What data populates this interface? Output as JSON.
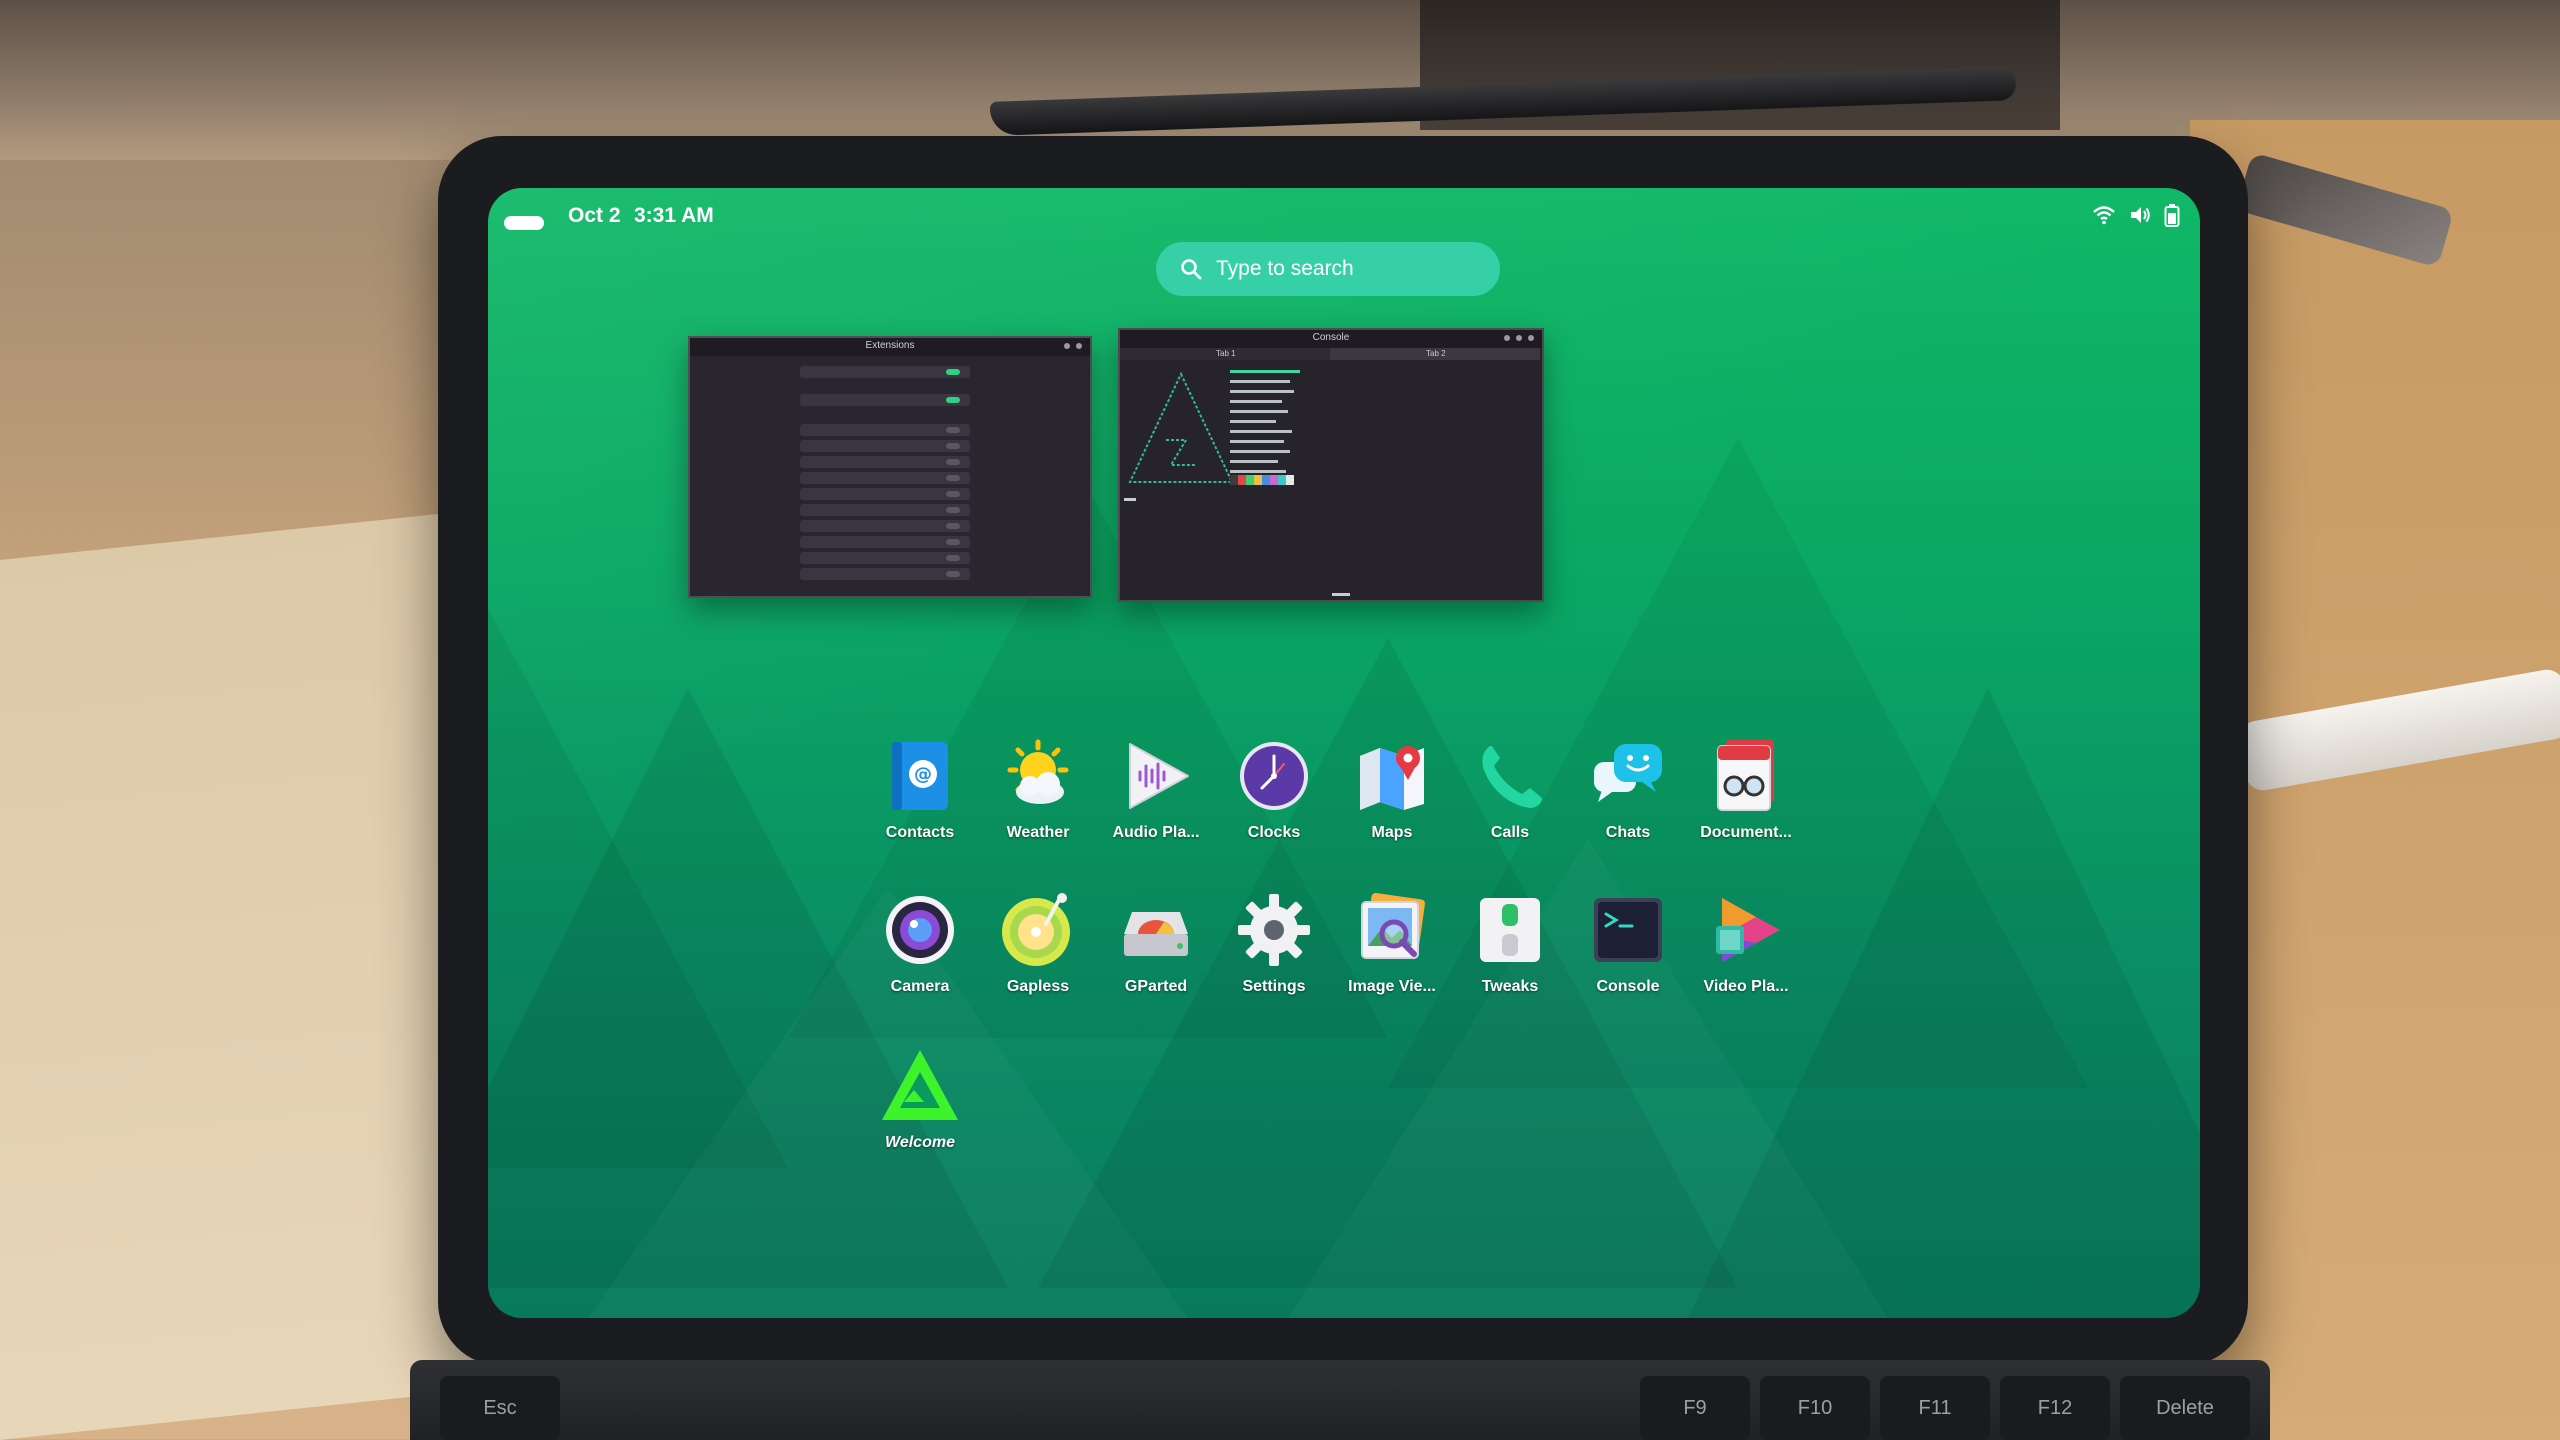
{
  "status_bar": {
    "date": "Oct 2",
    "time": "3:31 AM",
    "icons": [
      "wifi-icon",
      "volume-icon",
      "battery-icon"
    ]
  },
  "search": {
    "placeholder": "Type to search",
    "icon": "search-icon"
  },
  "windows": [
    {
      "name": "Extensions"
    },
    {
      "name": "Console",
      "tabs": [
        "Tab 1",
        "Tab 2"
      ]
    }
  ],
  "apps_row1": [
    {
      "label": "Contacts",
      "icon": "contacts-icon"
    },
    {
      "label": "Weather",
      "icon": "weather-icon"
    },
    {
      "label": "Audio Pla...",
      "icon": "audio-player-icon"
    },
    {
      "label": "Clocks",
      "icon": "clock-icon"
    },
    {
      "label": "Maps",
      "icon": "maps-icon"
    },
    {
      "label": "Calls",
      "icon": "phone-icon"
    },
    {
      "label": "Chats",
      "icon": "chat-icon"
    },
    {
      "label": "Document...",
      "icon": "document-viewer-icon"
    }
  ],
  "apps_row2": [
    {
      "label": "Camera",
      "icon": "camera-icon"
    },
    {
      "label": "Gapless",
      "icon": "music-disc-icon"
    },
    {
      "label": "GParted",
      "icon": "disk-partition-icon"
    },
    {
      "label": "Settings",
      "icon": "gear-icon"
    },
    {
      "label": "Image Vie...",
      "icon": "image-viewer-icon"
    },
    {
      "label": "Tweaks",
      "icon": "tweaks-icon"
    },
    {
      "label": "Console",
      "icon": "terminal-icon"
    },
    {
      "label": "Video Pla...",
      "icon": "video-player-icon"
    }
  ],
  "apps_row3": [
    {
      "label": "Welcome",
      "icon": "welcome-logo-icon"
    }
  ],
  "keyboard": {
    "keys": [
      "Esc",
      "F9",
      "F10",
      "F11",
      "F12",
      "Delete"
    ]
  },
  "colors": {
    "wallpaper_top": "#0fb866",
    "wallpaper_bottom": "#087a5c",
    "search_bg": "#35d0a8",
    "accent": "#2ed183"
  }
}
